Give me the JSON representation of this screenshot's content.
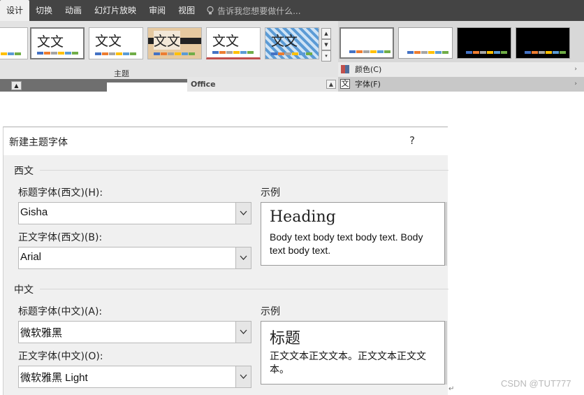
{
  "ribbon": {
    "tabs": [
      "设计",
      "切换",
      "动画",
      "幻灯片放映",
      "审阅",
      "视图"
    ],
    "active_tab": "设计",
    "tell_me": "告诉我您想要做什么...",
    "themes_group_label": "主题",
    "office_label": "Office",
    "theme_thumb_text": "文文",
    "swatch_colors": [
      "#4472c4",
      "#ed7d31",
      "#a5a5a5",
      "#ffc000",
      "#5b9bd5",
      "#70ad47"
    ],
    "variants_menu": {
      "colors": "颜色(C)",
      "fonts": "字体(F)"
    }
  },
  "dialog": {
    "title": "新建主题字体",
    "help": "?",
    "western": {
      "section": "西文",
      "heading_label": "标题字体(西文)(H):",
      "heading_value": "Gisha",
      "body_label": "正文字体(西文)(B):",
      "body_value": "Arial",
      "sample_label": "示例",
      "sample_heading": "Heading",
      "sample_body": "Body text body text body text. Body text body text."
    },
    "asian": {
      "section": "中文",
      "heading_label": "标题字体(中文)(A):",
      "heading_value": "微软雅黑",
      "body_label": "正文字体(中文)(O):",
      "body_value": "微软雅黑 Light",
      "sample_label": "示例",
      "sample_heading": "标题",
      "sample_body": "正文文本正文文本。正文文本正文文本。"
    }
  },
  "watermark": "CSDN @TUT777"
}
